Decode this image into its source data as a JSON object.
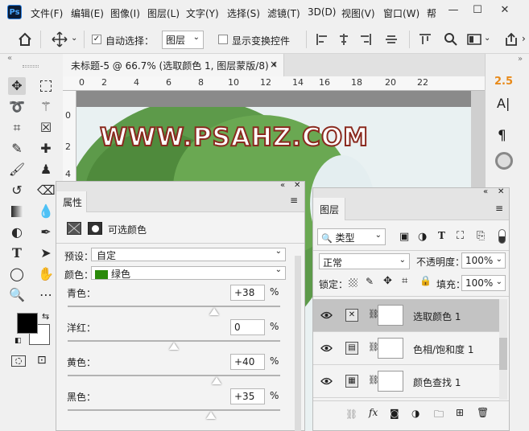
{
  "app": {
    "logo": "Ps"
  },
  "menu": [
    "文件(F)",
    "编辑(E)",
    "图像(I)",
    "图层(L)",
    "文字(Y)",
    "选择(S)",
    "滤镜(T)",
    "3D(D)",
    "视图(V)",
    "窗口(W)",
    "帮"
  ],
  "window_controls": {
    "min": "—",
    "restore": "☐",
    "close": "✕"
  },
  "options": {
    "auto_select_label": "自动选择：",
    "auto_select_checked": "✓",
    "target_value": "图层",
    "transform_label": "显示变换控件"
  },
  "document": {
    "tab_title": "未标题-5 @ 66.7% (选取颜色 1, 图层蒙版/8) *",
    "close": "×",
    "ruler_top": [
      "0",
      "2",
      "4",
      "6",
      "8",
      "10",
      "12",
      "14",
      "16",
      "18",
      "20",
      "22"
    ],
    "ruler_left": [
      "0",
      "2",
      "4"
    ],
    "watermark": "WWW.PSAHZ.COM"
  },
  "right_strip": {
    "item1": "2.5",
    "item2": "A|",
    "item3": "¶"
  },
  "properties": {
    "tab": "属性",
    "title": "可选颜色",
    "preset_label": "预设：",
    "preset_value": "自定",
    "colors_label": "颜色：",
    "colors_value": "绿色",
    "colors_swatch": "#2a8a0a",
    "sliders": [
      {
        "label": "青色：",
        "value": "+38",
        "level": 0.69
      },
      {
        "label": "洋红：",
        "value": "0",
        "level": 0.5
      },
      {
        "label": "黄色：",
        "value": "+40",
        "level": 0.7
      },
      {
        "label": "黑色：",
        "value": "+35",
        "level": 0.675
      }
    ],
    "percent": "%"
  },
  "layers": {
    "tab": "图层",
    "filter_kind": "类型",
    "blend_mode": "正常",
    "opacity_label": "不透明度：",
    "opacity_value": "100%",
    "lock_label": "锁定：",
    "fill_label": "填充：",
    "fill_value": "100%",
    "rows": [
      {
        "name": "选取颜色 1",
        "icon": "selective-color-icon",
        "selected": true
      },
      {
        "name": "色相/饱和度 1",
        "icon": "hue-saturation-icon",
        "selected": false
      },
      {
        "name": "颜色查找 1",
        "icon": "color-lookup-icon",
        "selected": false
      }
    ]
  },
  "colors": {
    "foreground": "#000000",
    "background": "#ffffff",
    "accent_orange": "#e88a1a"
  }
}
